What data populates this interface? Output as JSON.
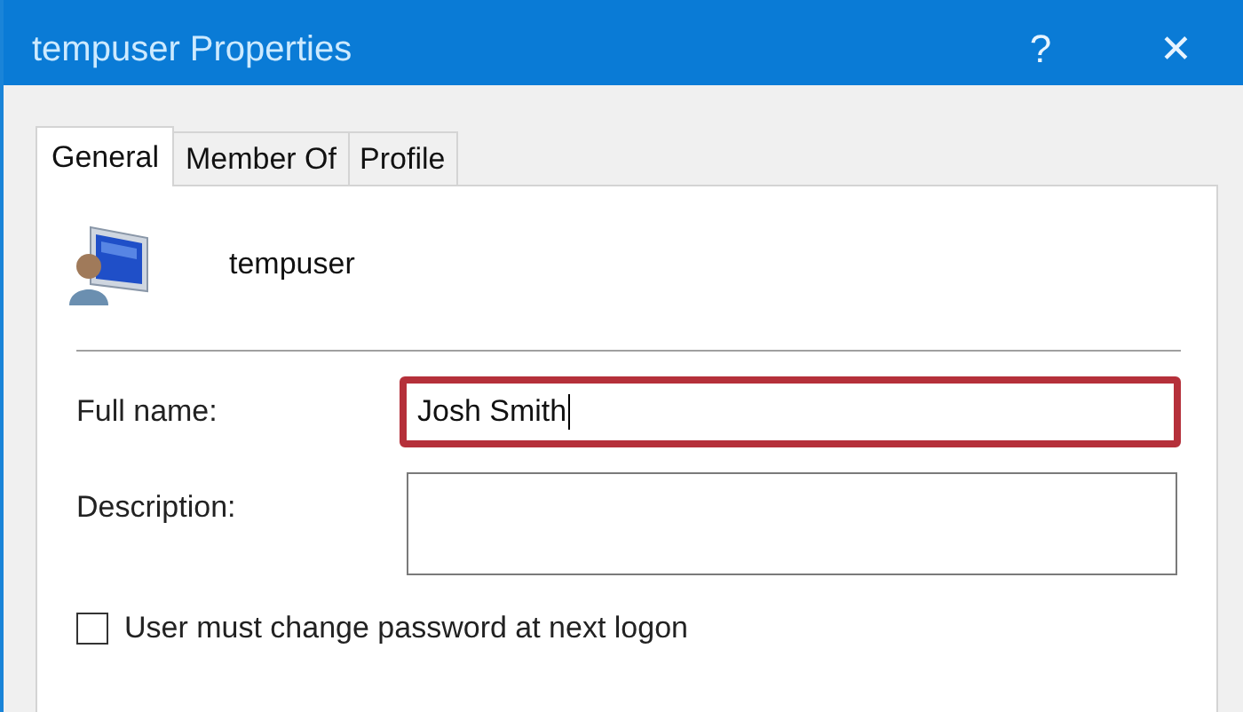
{
  "window": {
    "title": "tempuser Properties",
    "buttons": [
      "?",
      "✕"
    ]
  },
  "tabs": [
    {
      "label": "General",
      "selected": true
    },
    {
      "label": "Member Of",
      "selected": false
    },
    {
      "label": "Profile",
      "selected": false
    }
  ],
  "user": {
    "name": "tempuser"
  },
  "fields": [
    {
      "label": "Full name:",
      "value": "Josh Smith",
      "focused": true,
      "highlighted": true
    },
    {
      "label": "Description:",
      "focused": false,
      "highlighted": false
    }
  ],
  "options": [
    {
      "label": "User must change password at next logon",
      "checked": false
    }
  ]
}
